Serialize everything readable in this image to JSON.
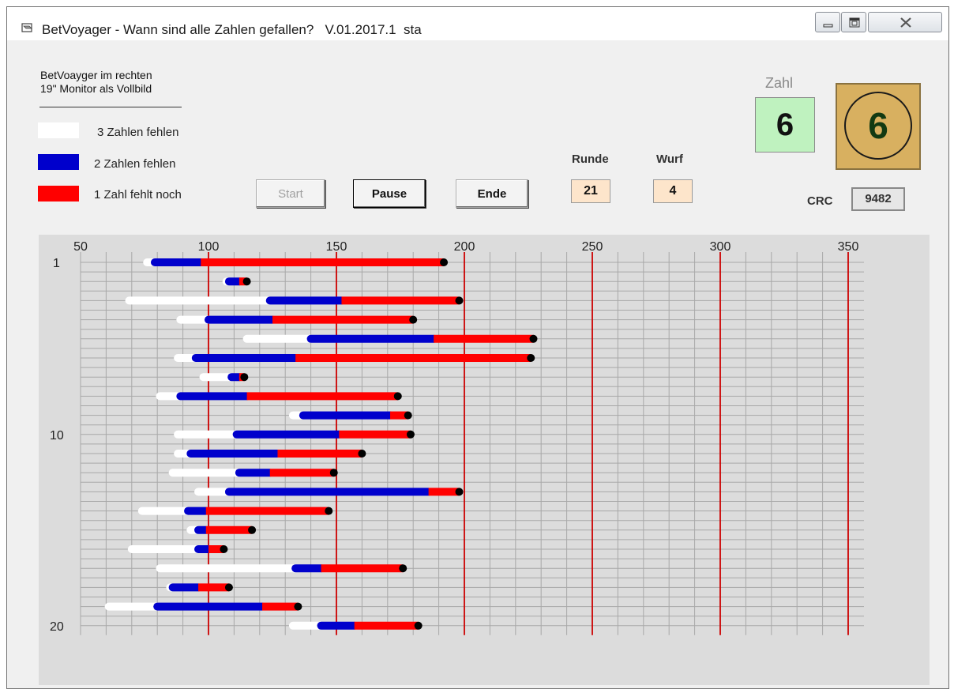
{
  "window": {
    "title": "BetVoyager - Wann sind alle Zahlen gefallen?   V.01.2017.1  sta",
    "controls": [
      "minimize-icon",
      "maximize-icon",
      "close-icon"
    ]
  },
  "note": {
    "line1": "BetVoayger im rechten",
    "line2": "19\" Monitor als Vollbild"
  },
  "legend": [
    {
      "label": "3 Zahlen fehlen",
      "color": "#ffffff"
    },
    {
      "label": "2 Zahlen fehlen",
      "color": "#0000cc"
    },
    {
      "label": "1 Zahl fehlt noch",
      "color": "#ff0000"
    }
  ],
  "buttons": {
    "start": "Start",
    "pause": "Pause",
    "ende": "Ende"
  },
  "runde": {
    "label": "Runde",
    "value": "21"
  },
  "wurf": {
    "label": "Wurf",
    "value": "4"
  },
  "zahl": {
    "label": "Zahl",
    "value": "6",
    "ball_value": "6"
  },
  "crc": {
    "label": "CRC",
    "value": "9482"
  },
  "chart_data": {
    "type": "bar",
    "orientation": "horizontal-ranges",
    "x_ticks": [
      50,
      100,
      150,
      200,
      250,
      300,
      350
    ],
    "xlim": [
      50,
      350
    ],
    "y_tick_labels": [
      {
        "row": 1,
        "label": "1"
      },
      {
        "row": 10,
        "label": "10"
      },
      {
        "row": 20,
        "label": "20"
      }
    ],
    "gridlines": true,
    "major_line_color": "#cc0000",
    "series_colors": {
      "three_missing": "#ffffff",
      "two_missing": "#0000cc",
      "one_missing": "#ff0000",
      "end": "#000000"
    },
    "rows": [
      {
        "row": 1,
        "start": 76,
        "blue": 79,
        "red": 97,
        "end": 192
      },
      {
        "row": 2,
        "start": 107,
        "blue": 108,
        "red": 112,
        "end": 115
      },
      {
        "row": 3,
        "start": 69,
        "blue": 124,
        "red": 152,
        "end": 198
      },
      {
        "row": 4,
        "start": 89,
        "blue": 100,
        "red": 125,
        "end": 180
      },
      {
        "row": 5,
        "start": 115,
        "blue": 140,
        "red": 188,
        "end": 227
      },
      {
        "row": 6,
        "start": 88,
        "blue": 95,
        "red": 134,
        "end": 226
      },
      {
        "row": 7,
        "start": 98,
        "blue": 109,
        "red": 112,
        "end": 114
      },
      {
        "row": 8,
        "start": 81,
        "blue": 89,
        "red": 115,
        "end": 174
      },
      {
        "row": 9,
        "start": 133,
        "blue": 137,
        "red": 171,
        "end": 178
      },
      {
        "row": 10,
        "start": 88,
        "blue": 111,
        "red": 151,
        "end": 179
      },
      {
        "row": 11,
        "start": 88,
        "blue": 93,
        "red": 127,
        "end": 160
      },
      {
        "row": 12,
        "start": 86,
        "blue": 112,
        "red": 124,
        "end": 149
      },
      {
        "row": 13,
        "start": 96,
        "blue": 108,
        "red": 186,
        "end": 198
      },
      {
        "row": 14,
        "start": 74,
        "blue": 92,
        "red": 99,
        "end": 147
      },
      {
        "row": 15,
        "start": 93,
        "blue": 96,
        "red": 99,
        "end": 117
      },
      {
        "row": 16,
        "start": 70,
        "blue": 96,
        "red": 100,
        "end": 106
      },
      {
        "row": 17,
        "start": 81,
        "blue": 134,
        "red": 144,
        "end": 176
      },
      {
        "row": 18,
        "start": 85,
        "blue": 86,
        "red": 96,
        "end": 108
      },
      {
        "row": 19,
        "start": 61,
        "blue": 80,
        "red": 121,
        "end": 135
      },
      {
        "row": 20,
        "start": 133,
        "blue": 144,
        "red": 157,
        "end": 182
      }
    ]
  }
}
